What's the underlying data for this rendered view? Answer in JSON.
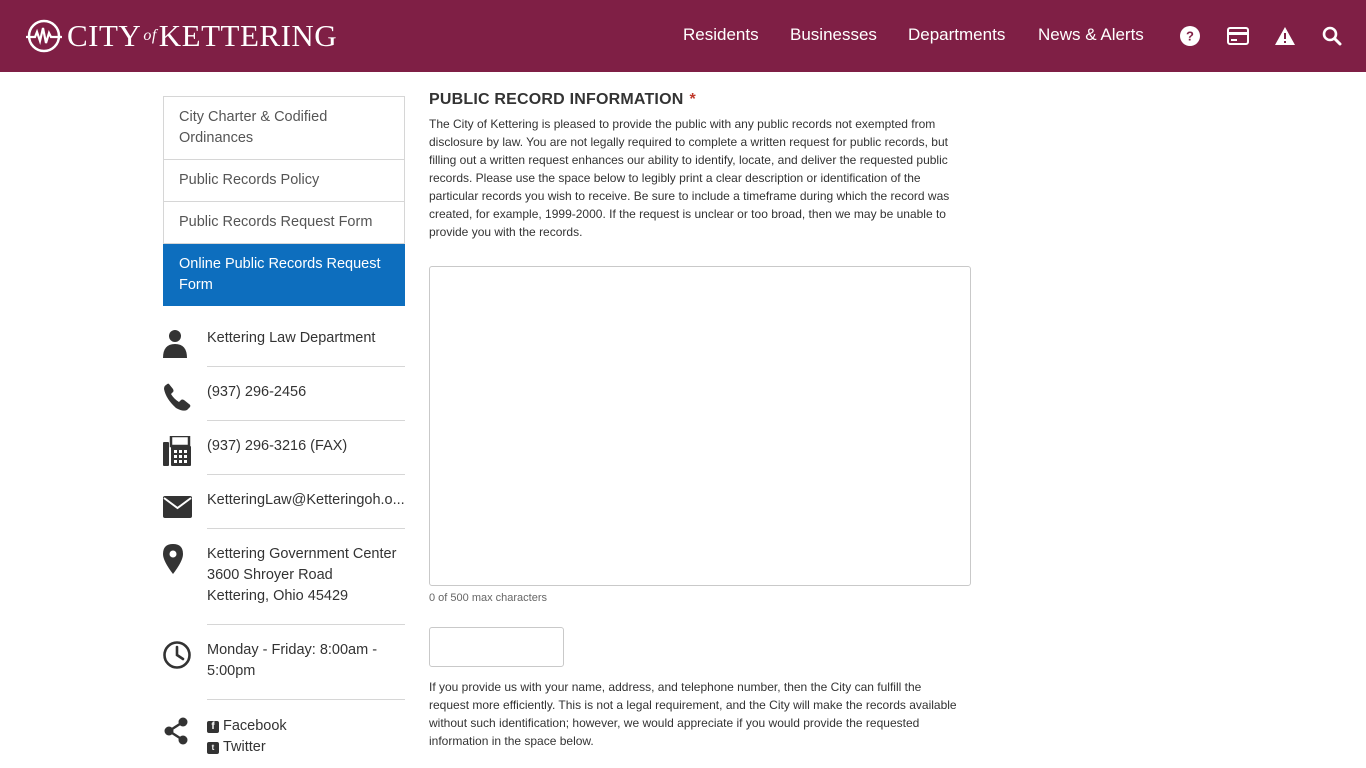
{
  "header": {
    "logo_city": "City",
    "logo_of": "of",
    "logo_name": "Kettering",
    "nav": [
      {
        "label": "Residents"
      },
      {
        "label": "Businesses"
      },
      {
        "label": "Departments"
      },
      {
        "label": "News & Alerts"
      }
    ],
    "icons": [
      "help-icon",
      "payment-card-icon",
      "alert-icon",
      "search-icon"
    ],
    "brand_color": "#7f1f45"
  },
  "sidebar": {
    "links": [
      {
        "label": "City Charter & Codified Ordinances"
      },
      {
        "label": "Public Records Policy"
      },
      {
        "label": "Public Records Request Form"
      },
      {
        "label": "Online Public Records Request Form",
        "active": true
      }
    ],
    "active_color": "#0d6ebe",
    "contacts": [
      {
        "icon": "person-icon",
        "text": "Kettering Law Department"
      },
      {
        "icon": "phone-icon",
        "text": "(937) 296-2456"
      },
      {
        "icon": "fax-icon",
        "text": "(937) 296-3216 (FAX)"
      },
      {
        "icon": "email-icon",
        "text": "KetteringLaw@Ketteringoh.o..."
      },
      {
        "icon": "map-pin-icon",
        "line1": "Kettering Government Center",
        "line2": "3600 Shroyer Road",
        "line3": "Kettering, Ohio 45429"
      },
      {
        "icon": "clock-icon",
        "text": "Monday - Friday: 8:00am - 5:00pm"
      }
    ],
    "social": {
      "icon": "share-icon",
      "facebook": "Facebook",
      "twitter": "Twitter"
    }
  },
  "main": {
    "title": "PUBLIC RECORD INFORMATION",
    "required_mark": "*",
    "description": "The City of Kettering is pleased to provide the public with any public records not exempted from disclosure by law. You are not legally required to complete a written request for public records, but filling out a written request enhances our ability to identify, locate, and deliver the requested public records. Please use the space below to legibly print a clear description or identification of the particular records you wish to receive. Be sure to include a timeframe during which the record was created, for example, 1999-2000. If the request is unclear or too broad, then we may be unable to provide you with the records.",
    "textarea_value": "",
    "char_counter": "0 of 500 max characters",
    "small_input_value": "",
    "description2": "If you provide us with your name, address, and telephone number, then the City can fulfill the request more efficiently. This is not a legal requirement, and the City will make the records available without such identification; however, we would appreciate if you would provide the requested information in the space below."
  }
}
